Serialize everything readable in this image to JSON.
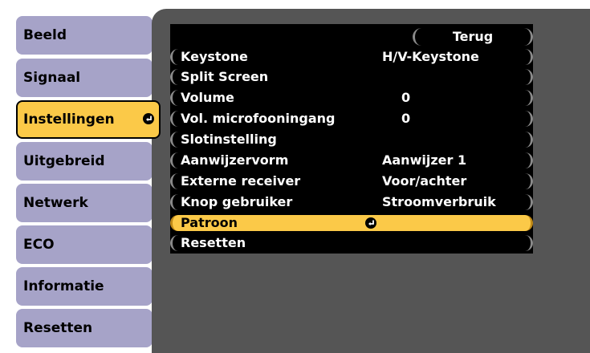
{
  "sidebar": {
    "tabs": [
      {
        "label": "Beeld"
      },
      {
        "label": "Signaal"
      },
      {
        "label": "Instellingen"
      },
      {
        "label": "Uitgebreid"
      },
      {
        "label": "Netwerk"
      },
      {
        "label": "ECO"
      },
      {
        "label": "Informatie"
      },
      {
        "label": "Resetten"
      }
    ],
    "active_tab": "Instellingen"
  },
  "menu": {
    "back_label": "Terug",
    "items": [
      {
        "label": "Keystone",
        "value": "H/V-Keystone"
      },
      {
        "label": "Split Screen",
        "value": ""
      },
      {
        "label": "Volume",
        "value": "0"
      },
      {
        "label": "Vol. microfooningang",
        "value": "0"
      },
      {
        "label": "Slotinstelling",
        "value": ""
      },
      {
        "label": "Aanwijzervorm",
        "value": "Aanwijzer 1"
      },
      {
        "label": "Externe receiver",
        "value": "Voor/achter"
      },
      {
        "label": "Knop gebruiker",
        "value": "Stroomverbruik"
      },
      {
        "label": "Patroon",
        "value": ""
      },
      {
        "label": "Resetten",
        "value": ""
      }
    ],
    "selected_item": "Patroon"
  },
  "colors": {
    "tab_bg": "#a6a3c8",
    "active_bg": "#fbc948",
    "panel_bg": "#555555",
    "menu_bg": "#000000"
  },
  "icons": {
    "enter": "enter-icon"
  }
}
